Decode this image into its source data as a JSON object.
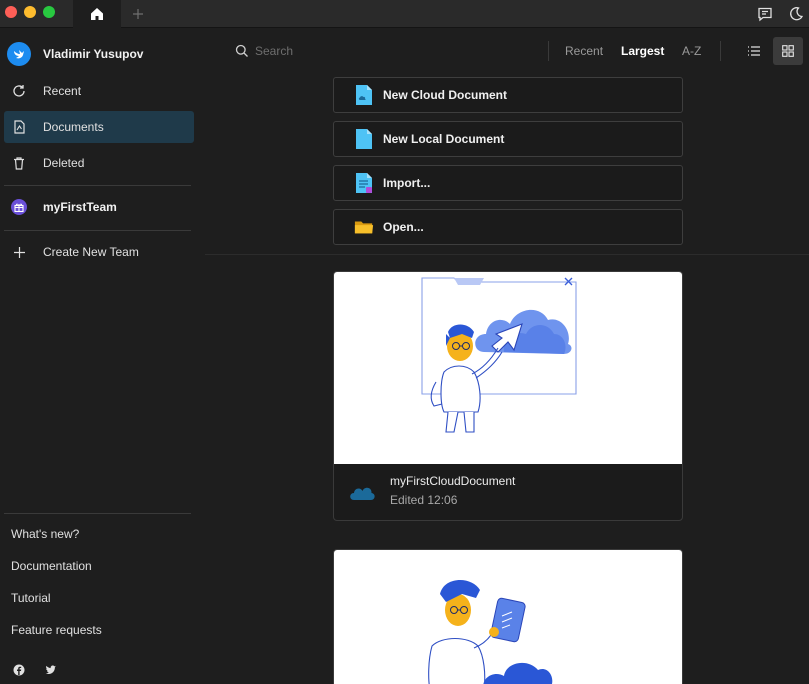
{
  "titlebar": {
    "tabs": [
      {
        "icon": "home-icon"
      },
      {
        "icon": "plus-icon"
      }
    ],
    "right_icons": [
      "feedback-icon",
      "moon-icon"
    ]
  },
  "sidebar": {
    "user": {
      "name": "Vladimir Yusupov",
      "icon": "bird-icon"
    },
    "items": [
      {
        "label": "Recent",
        "icon": "refresh-icon",
        "active": false
      },
      {
        "label": "Documents",
        "icon": "document-icon",
        "active": true
      },
      {
        "label": "Deleted",
        "icon": "trash-icon",
        "active": false
      }
    ],
    "team": {
      "label": "myFirstTeam",
      "icon": "gift-icon"
    },
    "create_team_label": "Create New Team",
    "footer_links": [
      "What's new?",
      "Documentation",
      "Tutorial",
      "Feature requests"
    ],
    "social_icons": [
      "facebook-icon",
      "twitter-icon"
    ]
  },
  "toolbar": {
    "search_placeholder": "Search",
    "sort_options": [
      {
        "label": "Recent",
        "selected": false
      },
      {
        "label": "Largest",
        "selected": true
      },
      {
        "label": "A-Z",
        "selected": false
      }
    ],
    "view_modes": [
      {
        "icon": "list-view-icon",
        "selected": false
      },
      {
        "icon": "grid-view-icon",
        "selected": true
      }
    ]
  },
  "actions": [
    {
      "label": "New Cloud Document",
      "icon": "cloud-document-icon"
    },
    {
      "label": "New Local Document",
      "icon": "local-document-icon"
    },
    {
      "label": "Import...",
      "icon": "import-icon"
    },
    {
      "label": "Open...",
      "icon": "folder-icon"
    }
  ],
  "documents": [
    {
      "name": "myFirstCloudDocument",
      "edited": "Edited 12:06",
      "icon": "cloud-icon"
    }
  ],
  "colors": {
    "accent": "#1d8cf0",
    "active_item": "#1f3a4a",
    "team": "#6a50d8",
    "cloud_doc": "#1b6a9a"
  }
}
